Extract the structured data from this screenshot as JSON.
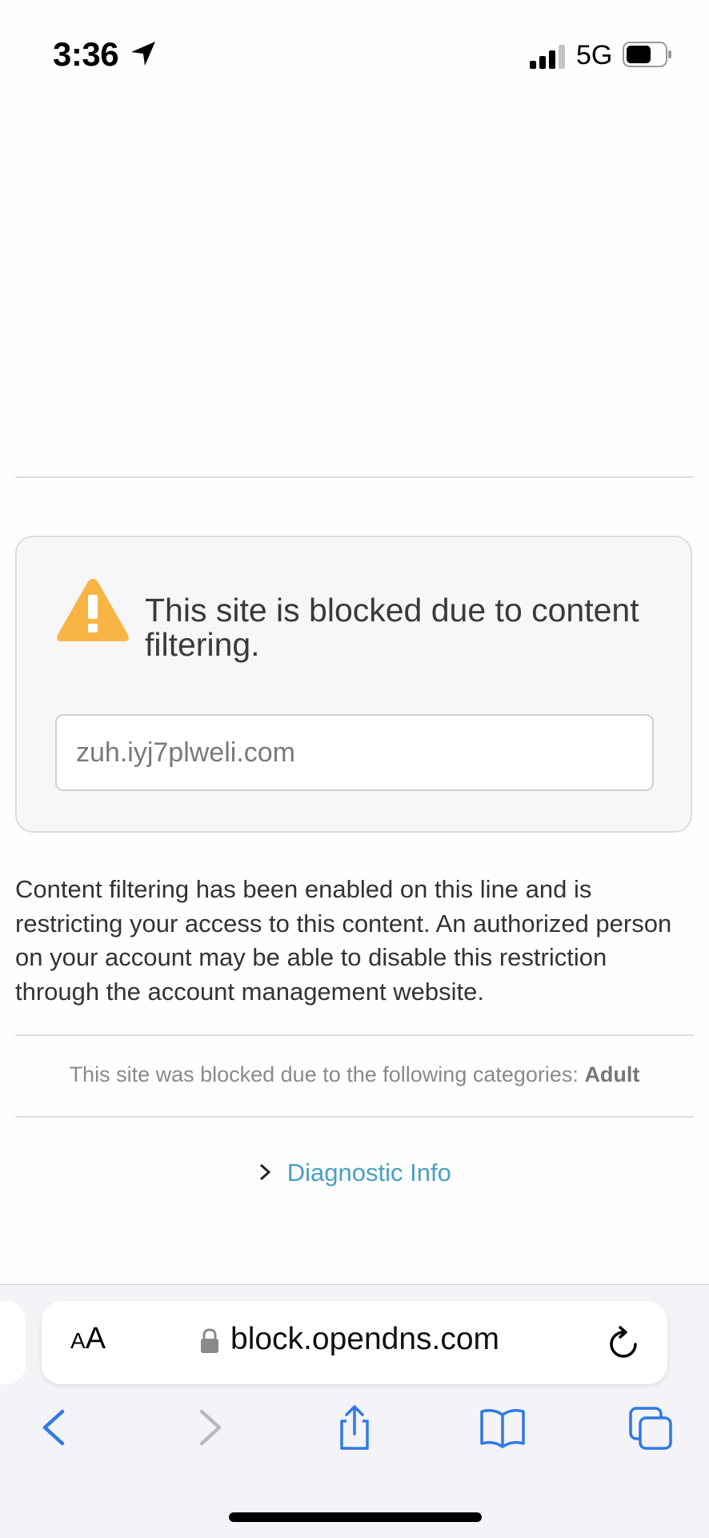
{
  "status": {
    "time": "3:36",
    "network": "5G"
  },
  "block": {
    "title": "This site is blocked due to content filtering.",
    "domain": "zuh.iyj7plweli.com",
    "explanation": "Content filtering has been enabled on this line and is restricting your access to this content. An authorized person on your account may be able to disable this restriction through the account management website.",
    "categories_prefix": "This site was blocked due to the following categories:",
    "category": "Adult",
    "diagnostic_label": "Diagnostic Info"
  },
  "browser": {
    "text_size_label_small": "A",
    "text_size_label_large": "A",
    "url": "block.opendns.com"
  },
  "colors": {
    "warning": "#f8b546",
    "link": "#4a9fc2",
    "toolbar_active": "#2f7ae5",
    "toolbar_disabled": "#b9b9bd"
  },
  "icons": [
    "location-arrow-icon",
    "signal-icon",
    "battery-icon",
    "warning-icon",
    "lock-icon",
    "reload-icon",
    "back-icon",
    "forward-icon",
    "share-icon",
    "bookmarks-icon",
    "tabs-icon"
  ]
}
